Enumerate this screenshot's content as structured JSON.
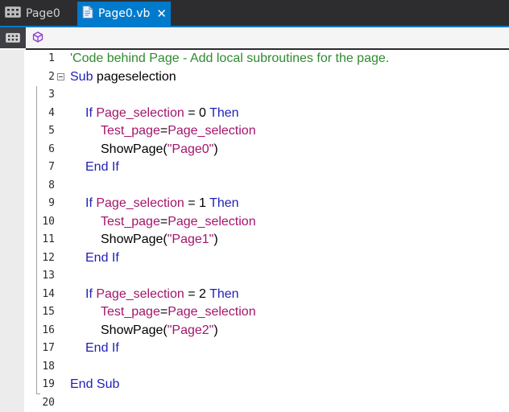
{
  "tabs": [
    {
      "label": "Page0",
      "active": false,
      "icon": "grid-icon"
    },
    {
      "label": "Page0.vb",
      "active": true,
      "icon": "code-file-icon",
      "close": "✕"
    }
  ],
  "toolbar": {
    "left_icon": "grid-icon",
    "right_icon": "cube-icon"
  },
  "colors": {
    "accent": "#007acc",
    "keyword": "#1f1fb7",
    "identifier": "#a3156b",
    "comment": "#2f8a2f"
  },
  "editor": {
    "lines": [
      {
        "n": "1",
        "comment": "'Code behind Page - Add local subroutines for the page."
      },
      {
        "n": "2",
        "kw": "Sub",
        "name": " pageselection"
      },
      {
        "n": "3"
      },
      {
        "n": "4",
        "kw1": "If",
        "var": "Page_selection",
        "op": " = 0 ",
        "kw2": "Then"
      },
      {
        "n": "5",
        "var1": "Test_page",
        "op": "=",
        "var2": "Page_selection"
      },
      {
        "n": "6",
        "fn": "ShowPage(",
        "str": "\"Page0\"",
        "close": ")"
      },
      {
        "n": "7",
        "kw": "End If"
      },
      {
        "n": "8"
      },
      {
        "n": "9",
        "kw1": "If",
        "var": "Page_selection",
        "op": " = 1 ",
        "kw2": "Then"
      },
      {
        "n": "10",
        "var1": "Test_page",
        "op": "=",
        "var2": "Page_selection"
      },
      {
        "n": "11",
        "fn": "ShowPage(",
        "str": "\"Page1\"",
        "close": ")"
      },
      {
        "n": "12",
        "kw": "End If"
      },
      {
        "n": "13"
      },
      {
        "n": "14",
        "kw1": "If",
        "var": "Page_selection",
        "op": " = 2 ",
        "kw2": "Then"
      },
      {
        "n": "15",
        "var1": "Test_page",
        "op": "=",
        "var2": "Page_selection"
      },
      {
        "n": "16",
        "fn": "ShowPage(",
        "str": "\"Page2\"",
        "close": ")"
      },
      {
        "n": "17",
        "kw": "End If"
      },
      {
        "n": "18"
      },
      {
        "n": "19",
        "kw": "End Sub"
      },
      {
        "n": "20"
      }
    ]
  }
}
